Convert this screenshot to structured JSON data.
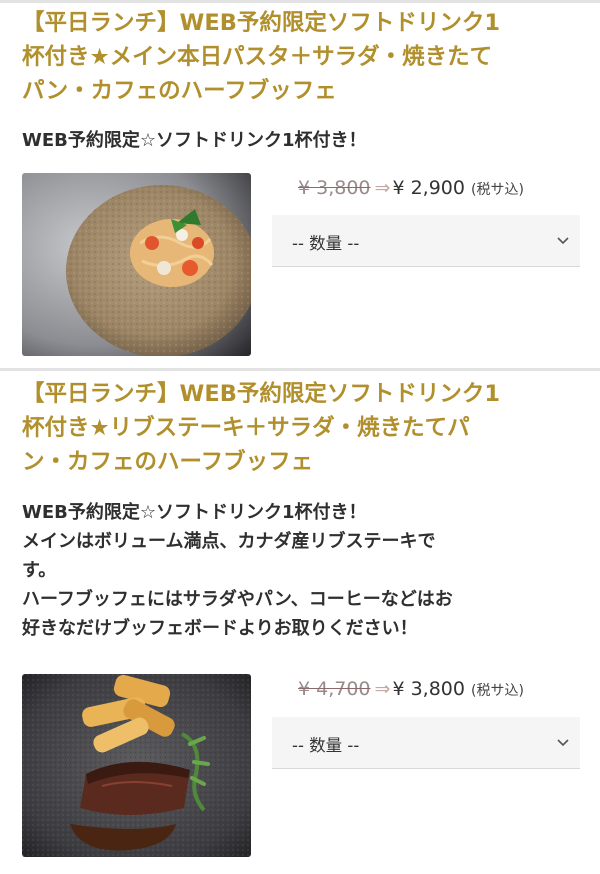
{
  "products": [
    {
      "title": "【平日ランチ】WEB予約限定ソフトドリンク1杯付き★メイン本日パスタ＋サラダ・焼きたてパン・カフェのハーフブッフェ",
      "title_lines": [
        "【平日ランチ】WEB予約限定ソフトドリンク1",
        "杯付き★メイン本日パスタ＋サラダ・焼きたて",
        "パン・カフェのハーフブッフェ"
      ],
      "description_lines": [
        "WEB予約限定☆ソフトドリンク1杯付き！"
      ],
      "image_icon": "pasta-dish-photo",
      "old_price": "¥ 3,800",
      "arrow": "⇒",
      "new_price": "¥ 2,900",
      "tax_note": "(税サ込)",
      "quantity_placeholder": "-- 数量 --"
    },
    {
      "title": "【平日ランチ】WEB予約限定ソフトドリンク1杯付き★リブステーキ＋サラダ・焼きたてパン・カフェのハーフブッフェ",
      "title_lines": [
        "【平日ランチ】WEB予約限定ソフトドリンク1",
        "杯付き★リブステーキ＋サラダ・焼きたてパ",
        "ン・カフェのハーフブッフェ"
      ],
      "description_lines": [
        "WEB予約限定☆ソフトドリンク1杯付き！",
        "メインはボリューム満点、カナダ産リブステーキで",
        "す。",
        "ハーフブッフェにはサラダやパン、コーヒーなどはお",
        "好きなだけブッフェボードよりお取りください！"
      ],
      "image_icon": "steak-dish-photo",
      "old_price": "¥ 4,700",
      "arrow": "⇒",
      "new_price": "¥ 3,800",
      "tax_note": "(税サ込)",
      "quantity_placeholder": "-- 数量 --"
    }
  ],
  "colors": {
    "title": "#b08f2c",
    "description": "#2f2f2f",
    "strike_price": "#9a8a8a",
    "select_bg": "#f5f5f5",
    "divider": "#e2e2e2"
  }
}
